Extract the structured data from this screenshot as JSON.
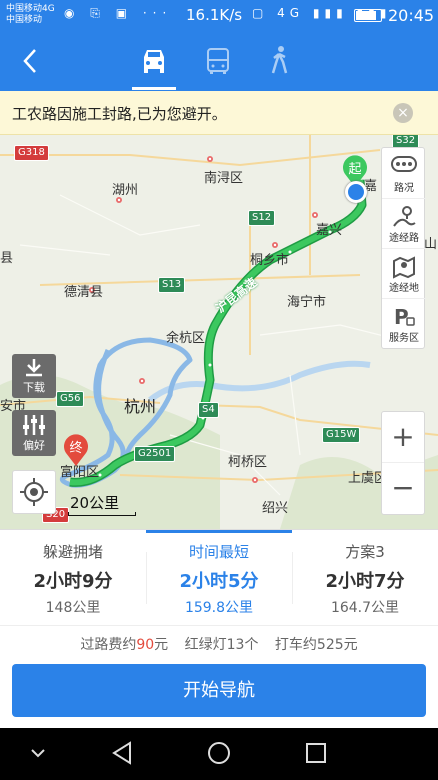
{
  "status_bar": {
    "carrier_1": "中国移动4G",
    "carrier_2": "中国移动",
    "net_speed": "16.1K/s",
    "clock": "20:45",
    "battery_level": 0.85,
    "left_icons": "◉ ⎘ ▣ ···",
    "right_icons": "▢ 4G ▮▮▮ ▮▮▮"
  },
  "nav": {
    "back_icon": "chevron-left-icon",
    "modes": [
      "car-icon",
      "bus-icon",
      "walk-icon"
    ],
    "active_mode": "car"
  },
  "notice": {
    "text": "工农路因施工封路,已为您避开。",
    "close_icon": "close-icon"
  },
  "map": {
    "labels": {
      "nanxun": "南浔区",
      "huzhou": "湖州",
      "jiaxing_short": "嘉",
      "jiaxing": "嘉兴",
      "tongxiang": "桐乡市",
      "deqing": "德清县",
      "haining": "海宁市",
      "yuhang": "余杭区",
      "hangzhou": "杭州",
      "keqiao": "柯桥区",
      "shangyu": "上虞区",
      "fuyang": "富阳区",
      "shaoxing": "绍兴",
      "edge_an": "安市",
      "edge_xian": "县",
      "edge_shan": "山",
      "expressway": "沪昆高速"
    },
    "road_shields": {
      "g318": "G318",
      "s32": "S32",
      "s12": "S12",
      "s13": "S13",
      "g56": "G56",
      "s4": "S4",
      "g2501": "G2501",
      "g15w": "G15W",
      "s20": "S20"
    },
    "start_label": "起",
    "end_label": "终",
    "scale": "20公里",
    "side_panel": [
      {
        "icon": "traffic-icon",
        "label": "路况"
      },
      {
        "icon": "waypoint-icon",
        "label": "途经路"
      },
      {
        "icon": "map-pin-icon",
        "label": "途经地"
      },
      {
        "icon": "parking-icon",
        "label": "服务区"
      }
    ],
    "download_label": "下载",
    "preference_label": "偏好",
    "zoom_in": "+",
    "zoom_out": "−"
  },
  "plans": [
    {
      "name": "躲避拥堵",
      "time": "2小时9分",
      "distance": "148公里",
      "active": false
    },
    {
      "name": "时间最短",
      "time": "2小时5分",
      "distance": "159.8公里",
      "active": true
    },
    {
      "name": "方案3",
      "time": "2小时7分",
      "distance": "164.7公里",
      "active": false
    }
  ],
  "info": {
    "toll_prefix": "过路费约",
    "toll_value": "90",
    "toll_suffix": "元",
    "lights": "红绿灯13个",
    "taxi": "打车约525元"
  },
  "start_button": "开始导航",
  "colors": {
    "primary": "#2b82e8",
    "route": "#3cc85f",
    "alt_route": "#8ab8e6",
    "notice_bg": "#fdf8d7",
    "toll_red": "#e34b3d"
  }
}
